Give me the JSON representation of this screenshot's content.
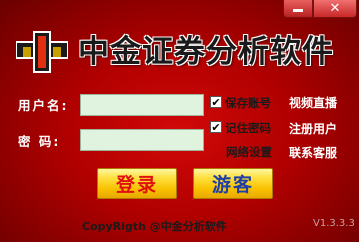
{
  "window": {
    "title": "中金证券分析软件",
    "minimize_icon": "minimize-icon",
    "close_icon": "close-icon",
    "close_glyph": "✕",
    "logo_icon": "logo-icon"
  },
  "form": {
    "username_label": "用户名:",
    "username_value": "",
    "password_label": "密  码:",
    "password_value": ""
  },
  "options": {
    "save_account": {
      "label": "保存账号",
      "checked": true
    },
    "remember_password": {
      "label": "记住密码",
      "checked": true
    },
    "check_glyph": "✔",
    "network_settings": "网络设置"
  },
  "links": {
    "video_live": "视频直播",
    "register": "注册用户",
    "customer_service": "联系客服"
  },
  "buttons": {
    "login": "登录",
    "guest": "游客"
  },
  "footer": {
    "copyright": "CopyRigth @中金分析软件",
    "version": "V1.3.3.3"
  },
  "colors": {
    "background": "#b00000",
    "button_yellow": "#f8c000",
    "login_text": "#e01010",
    "guest_text": "#1e3ea8",
    "field_bg": "#dff3df"
  }
}
